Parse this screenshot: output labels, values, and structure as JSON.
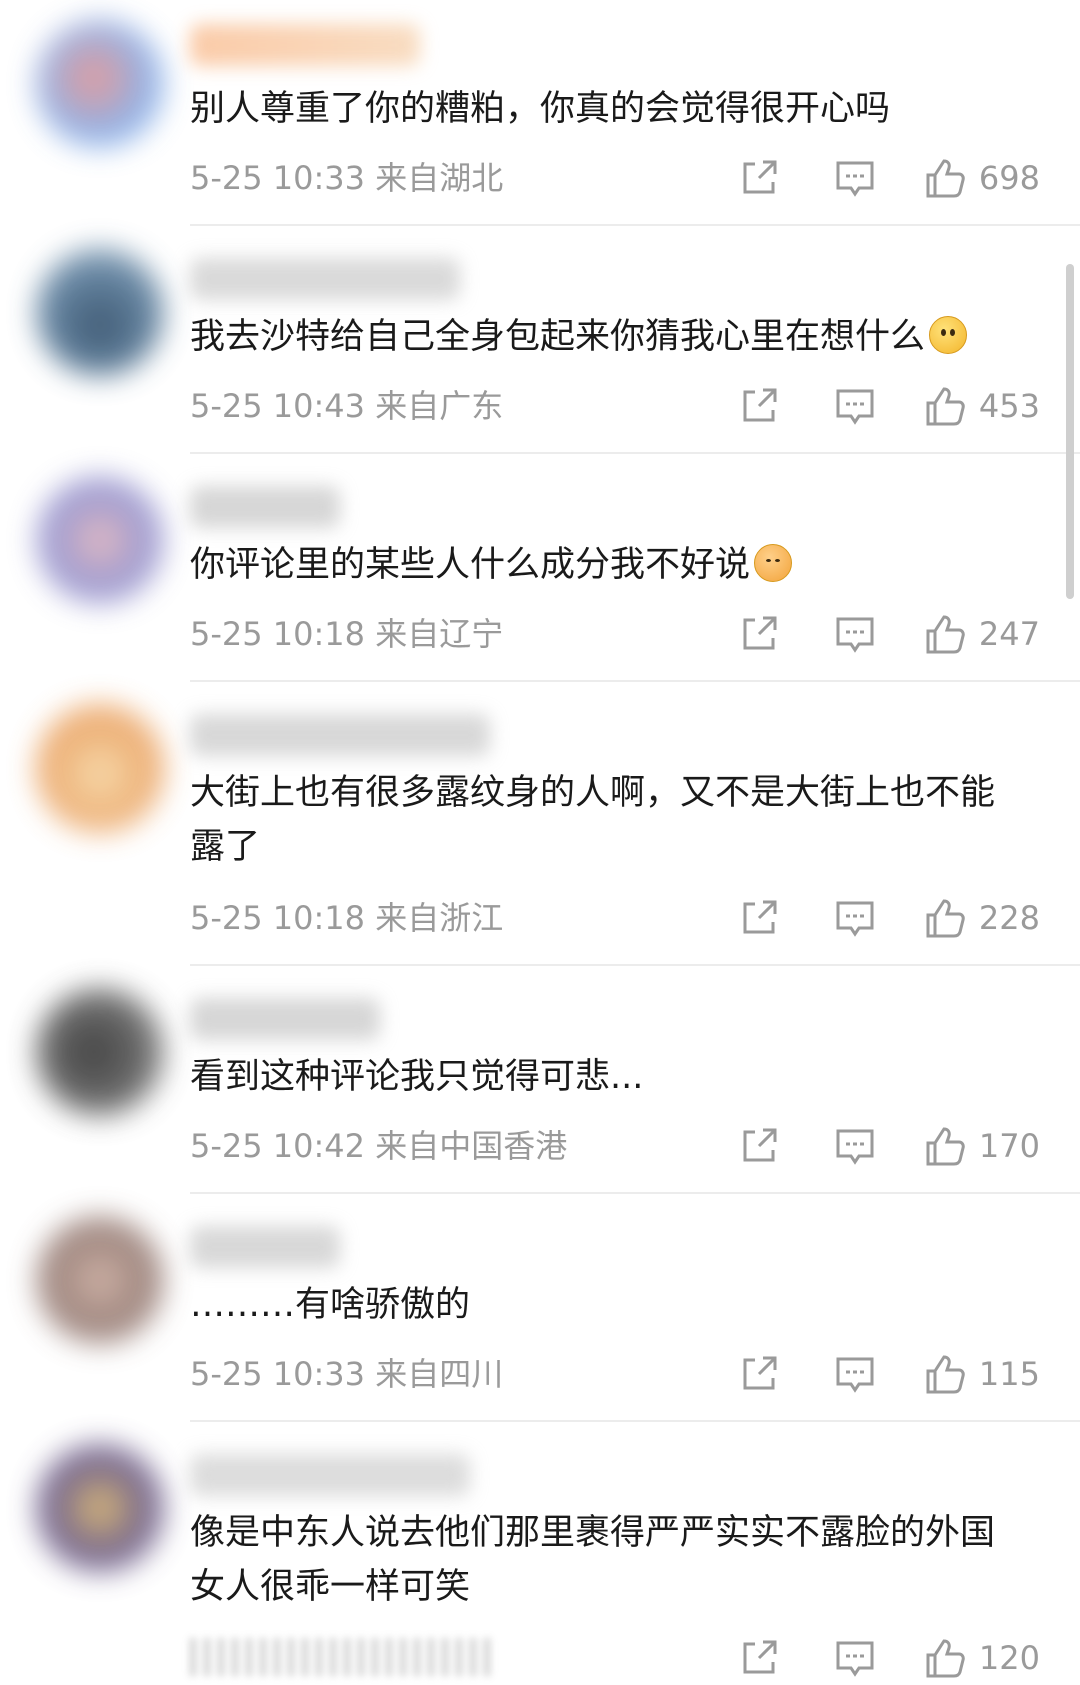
{
  "colors": {
    "text": "#1a1a1a",
    "meta": "#9a9a9a",
    "divider": "#ececec",
    "icon": "#9a9a9a"
  },
  "icons": {
    "repost": "share-out-icon",
    "reply": "comment-bubble-icon",
    "like": "thumbs-up-icon"
  },
  "comments": [
    {
      "text": "别人尊重了你的糟粕，你真的会觉得很开心吗",
      "emoji": "",
      "time": "5-25 10:33",
      "location": "来自湖北",
      "likes": "698"
    },
    {
      "text": "我去沙特给自己全身包起来你猜我心里在想什么",
      "emoji": "smile-emoji",
      "time": "5-25 10:43",
      "location": "来自广东",
      "likes": "453"
    },
    {
      "text": "你评论里的某些人什么成分我不好说",
      "emoji": "shy-smile-emoji",
      "time": "5-25 10:18",
      "location": "来自辽宁",
      "likes": "247"
    },
    {
      "text": "大街上也有很多露纹身的人啊，又不是大街上也不能露了",
      "emoji": "",
      "time": "5-25 10:18",
      "location": "来自浙江",
      "likes": "228"
    },
    {
      "text": "看到这种评论我只觉得可悲...",
      "emoji": "",
      "time": "5-25 10:42",
      "location": "来自中国香港",
      "likes": "170"
    },
    {
      "text": "………有啥骄傲的",
      "emoji": "",
      "time": "5-25 10:33",
      "location": "来自四川",
      "likes": "115"
    },
    {
      "text": "像是中东人说去他们那里裹得严严实实不露脸的外国女人很乖一样可笑",
      "emoji": "",
      "time": "",
      "location": "",
      "likes": "120"
    }
  ]
}
